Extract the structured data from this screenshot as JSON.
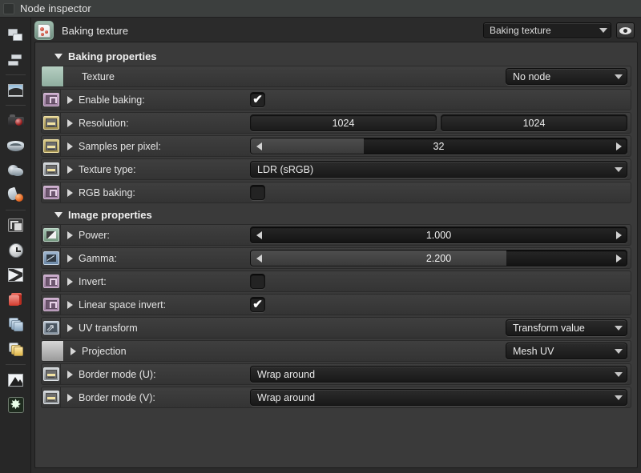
{
  "window": {
    "title": "Node inspector",
    "titlebar_icon": "panel-icon"
  },
  "rail": {
    "items": [
      {
        "name": "windows-icon",
        "label": "Windows"
      },
      {
        "name": "bars-icon",
        "label": "Layers"
      },
      {
        "name": "image-icon",
        "label": "Image"
      },
      {
        "name": "camera-icon",
        "label": "Camera"
      },
      {
        "name": "coil-icon",
        "label": "Geometry"
      },
      {
        "name": "coil2-icon",
        "label": "Surface"
      },
      {
        "name": "drop-icon",
        "label": "Material"
      },
      {
        "name": "crop-icon",
        "label": "Crop"
      },
      {
        "name": "clock-icon",
        "label": "Time"
      },
      {
        "name": "noise-icon",
        "label": "Noise"
      },
      {
        "name": "cube-icon",
        "label": "Object"
      },
      {
        "name": "stack-blue-icon",
        "label": "Stack"
      },
      {
        "name": "stack-gold-icon",
        "label": "Cache"
      },
      {
        "name": "histogram-icon",
        "label": "Histogram"
      },
      {
        "name": "star-icon",
        "label": "Effects"
      }
    ]
  },
  "node_header": {
    "icon": "baking-texture-node-icon",
    "title": "Baking texture",
    "selector_value": "Baking texture",
    "eye_icon": "eye-icon"
  },
  "groups": [
    {
      "title": "Baking properties",
      "rows": [
        {
          "label": "Texture",
          "swatch": "plain-green",
          "expand": false,
          "control": "dropdown-right",
          "value": "No node"
        },
        {
          "label": "Enable baking:",
          "swatch": "violet",
          "expand": true,
          "control": "checkbox",
          "checked": true
        },
        {
          "label": "Resolution:",
          "swatch": "gold",
          "expand": true,
          "control": "numbox-pair",
          "value": "1024",
          "value2": "1024"
        },
        {
          "label": "Samples per pixel:",
          "swatch": "gold",
          "expand": true,
          "control": "slider",
          "value": "32",
          "fill_percent": 30
        },
        {
          "label": "Texture type:",
          "swatch": "steel",
          "expand": true,
          "control": "dropdown-full",
          "value": "LDR (sRGB)"
        },
        {
          "label": "RGB baking:",
          "swatch": "violet",
          "expand": true,
          "control": "checkbox",
          "checked": false
        }
      ]
    },
    {
      "title": "Image properties",
      "rows": [
        {
          "label": "Power:",
          "swatch": "green",
          "expand": true,
          "control": "slider",
          "value": "1.000",
          "fill_percent": 0
        },
        {
          "label": "Gamma:",
          "swatch": "blue",
          "expand": true,
          "control": "slider",
          "value": "2.200",
          "fill_percent": 68
        },
        {
          "label": "Invert:",
          "swatch": "violet",
          "expand": true,
          "control": "checkbox",
          "checked": false
        },
        {
          "label": "Linear space invert:",
          "swatch": "violet",
          "expand": true,
          "control": "checkbox",
          "checked": true
        },
        {
          "label": "UV transform",
          "swatch": "arrows",
          "expand": true,
          "control": "dropdown-right",
          "value": "Transform value"
        },
        {
          "label": "Projection",
          "swatch": "plain-grey",
          "expand": true,
          "control": "dropdown-right",
          "value": "Mesh UV"
        },
        {
          "label": "Border mode (U):",
          "swatch": "steel",
          "expand": true,
          "control": "dropdown-full",
          "value": "Wrap around"
        },
        {
          "label": "Border mode (V):",
          "swatch": "steel",
          "expand": true,
          "control": "dropdown-full",
          "value": "Wrap around"
        }
      ]
    }
  ],
  "glyphs": {
    "check": "✔",
    "star": "✸"
  },
  "colors": {
    "panel_bg": "#3a3a3a",
    "window_bg": "#2b2b2b",
    "titlebar_bg": "#3c3f3e",
    "text": "#e4e4e4",
    "accent_violet": "#c6a8c8",
    "accent_gold": "#d9c98a",
    "accent_green": "#a7c6b4"
  }
}
